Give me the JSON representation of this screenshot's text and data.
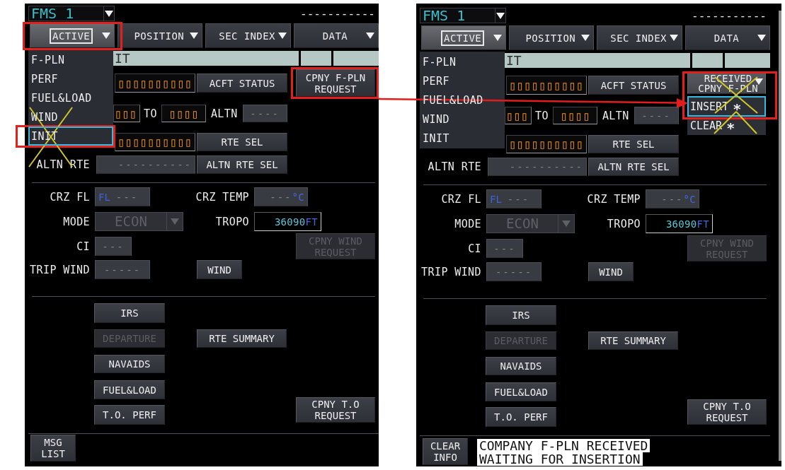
{
  "panels": [
    {
      "fms_selector": {
        "value": "FMS 1"
      },
      "header_dashes": "-----------",
      "tabs": [
        {
          "label": "ACTIVE",
          "selected": true,
          "highlighted": true,
          "menu": {
            "crossed": true,
            "items": [
              {
                "label": "F-PLN",
                "selected": false,
                "highlighted": false
              },
              {
                "label": "PERF",
                "selected": false,
                "highlighted": false
              },
              {
                "label": "FUEL&LOAD",
                "selected": false,
                "highlighted": false
              },
              {
                "label": "WIND",
                "selected": false,
                "highlighted": false
              },
              {
                "label": "INIT",
                "selected": true,
                "highlighted": true
              }
            ]
          }
        },
        {
          "label": "POSITION",
          "selected": false,
          "highlighted": false
        },
        {
          "label": "SEC INDEX",
          "selected": false,
          "highlighted": false
        },
        {
          "label": "DATA",
          "selected": false,
          "highlighted": false
        }
      ],
      "title_bar": {
        "title": "IT"
      },
      "entry_rows": [
        {
          "kind": "field_button",
          "field": {
            "kind": "amber",
            "value": "▯▯▯▯▯▯▯▯▯▯"
          },
          "button": {
            "label": "ACFT STATUS",
            "disabled": false
          }
        },
        {
          "kind": "from_to",
          "from_field": {
            "kind": "amber",
            "value": "▯▯▯"
          },
          "to_label": "TO",
          "to_field": {
            "kind": "amber",
            "value": "▯▯▯▯"
          },
          "altn_label": "ALTN",
          "altn_field": {
            "kind": "empty",
            "placeholder": "----"
          }
        },
        {
          "kind": "field_button",
          "field": {
            "kind": "amber",
            "value": "▯▯▯▯▯▯▯▯▯▯"
          },
          "button": {
            "label": "RTE SEL",
            "disabled": false
          }
        },
        {
          "kind": "field_button",
          "label": "ALTN RTE",
          "field": {
            "kind": "empty",
            "placeholder": "----------"
          },
          "button": {
            "label": "ALTN RTE SEL",
            "disabled": false
          }
        }
      ],
      "company_fpln": {
        "kind": "button",
        "label": "CPNY F-PLN REQUEST",
        "highlighted": true,
        "crossed": false
      },
      "cruise": {
        "crz_fl": {
          "label": "CRZ FL",
          "field": {
            "kind": "empty",
            "prefix": "FL",
            "placeholder": "---"
          }
        },
        "crz_temp": {
          "label": "CRZ TEMP",
          "field": {
            "kind": "empty",
            "placeholder": "---",
            "unit": "°C"
          }
        },
        "mode": {
          "label": "MODE",
          "value": "ECON",
          "disabled": true
        },
        "tropo": {
          "label": "TROPO",
          "field": {
            "kind": "value",
            "value": "36090",
            "unit": "FT"
          }
        },
        "cpny_wind_request": {
          "label": "CPNY WIND REQUEST",
          "disabled": true
        },
        "ci": {
          "label": "CI",
          "field": {
            "kind": "empty",
            "placeholder": "---"
          }
        },
        "trip_wind": {
          "label": "TRIP WIND",
          "field": {
            "kind": "empty",
            "placeholder": "-----"
          }
        },
        "wind_button": {
          "label": "WIND",
          "disabled": false
        }
      },
      "page_buttons": [
        {
          "label": "IRS",
          "disabled": false
        },
        {
          "label": "DEPARTURE",
          "disabled": true
        },
        {
          "label": "NAVAIDS",
          "disabled": false
        },
        {
          "label": "FUEL&LOAD",
          "disabled": false
        },
        {
          "label": "T.O. PERF",
          "disabled": false
        }
      ],
      "rte_summary_button": {
        "label": "RTE SUMMARY",
        "disabled": false
      },
      "cpny_to_request": {
        "label": "CPNY T.O REQUEST",
        "disabled": false
      },
      "footer": {
        "button": {
          "label": "MSG LIST"
        }
      },
      "scrollbar_shown": false
    },
    {
      "fms_selector": {
        "value": "FMS 1"
      },
      "header_dashes": "-----------",
      "tabs": [
        {
          "label": "ACTIVE",
          "selected": true,
          "highlighted": false,
          "menu": {
            "crossed": false,
            "items": [
              {
                "label": "F-PLN",
                "selected": false,
                "highlighted": false
              },
              {
                "label": "PERF",
                "selected": false,
                "highlighted": false
              },
              {
                "label": "FUEL&LOAD",
                "selected": false,
                "highlighted": false
              },
              {
                "label": "WIND",
                "selected": false,
                "highlighted": false
              },
              {
                "label": "INIT",
                "selected": false,
                "highlighted": false
              }
            ]
          }
        },
        {
          "label": "POSITION",
          "selected": false,
          "highlighted": false
        },
        {
          "label": "SEC INDEX",
          "selected": false,
          "highlighted": false
        },
        {
          "label": "DATA",
          "selected": false,
          "highlighted": false
        }
      ],
      "title_bar": {
        "title": "IT"
      },
      "entry_rows": [
        {
          "kind": "field_button",
          "field": {
            "kind": "amber",
            "value": "▯▯▯▯▯▯▯▯▯▯"
          },
          "button": {
            "label": "ACFT STATUS",
            "disabled": false
          }
        },
        {
          "kind": "from_to",
          "from_field": {
            "kind": "amber",
            "value": "▯▯▯"
          },
          "to_label": "TO",
          "to_field": {
            "kind": "amber",
            "value": "▯▯▯▯"
          },
          "altn_label": "ALTN",
          "altn_field": {
            "kind": "empty",
            "placeholder": "----"
          }
        },
        {
          "kind": "field_button",
          "field": {
            "kind": "amber",
            "value": "▯▯▯▯▯▯▯▯▯▯"
          },
          "button": {
            "label": "RTE SEL",
            "disabled": false
          }
        },
        {
          "kind": "field_button",
          "label": "ALTN RTE",
          "field": {
            "kind": "empty",
            "placeholder": "----------"
          },
          "button": {
            "label": "ALTN RTE SEL",
            "disabled": false
          }
        }
      ],
      "company_fpln": {
        "kind": "menu",
        "label": "RECEIVED CPNY F-PLN",
        "highlighted": true,
        "crossed": true,
        "items": [
          {
            "label": "INSERT",
            "symbol": "*",
            "selected": true
          },
          {
            "label": "CLEAR",
            "symbol": "*",
            "selected": false
          }
        ]
      },
      "cruise": {
        "crz_fl": {
          "label": "CRZ FL",
          "field": {
            "kind": "empty",
            "prefix": "FL",
            "placeholder": "---"
          }
        },
        "crz_temp": {
          "label": "CRZ TEMP",
          "field": {
            "kind": "empty",
            "placeholder": "---",
            "unit": "°C"
          }
        },
        "mode": {
          "label": "MODE",
          "value": "ECON",
          "disabled": true
        },
        "tropo": {
          "label": "TROPO",
          "field": {
            "kind": "value",
            "value": "36090",
            "unit": "FT"
          }
        },
        "cpny_wind_request": {
          "label": "CPNY WIND REQUEST",
          "disabled": true
        },
        "ci": {
          "label": "CI",
          "field": {
            "kind": "empty",
            "placeholder": "---"
          }
        },
        "trip_wind": {
          "label": "TRIP WIND",
          "field": {
            "kind": "empty",
            "placeholder": "-----"
          }
        },
        "wind_button": {
          "label": "WIND",
          "disabled": false
        }
      },
      "page_buttons": [
        {
          "label": "IRS",
          "disabled": false
        },
        {
          "label": "DEPARTURE",
          "disabled": true
        },
        {
          "label": "NAVAIDS",
          "disabled": false
        },
        {
          "label": "FUEL&LOAD",
          "disabled": false
        },
        {
          "label": "T.O. PERF",
          "disabled": false
        }
      ],
      "rte_summary_button": {
        "label": "RTE SUMMARY",
        "disabled": false
      },
      "cpny_to_request": {
        "label": "CPNY T.O REQUEST",
        "disabled": false
      },
      "footer": {
        "button": {
          "label": "CLEAR INFO"
        },
        "message_lines": [
          "COMPANY F-PLN RECEIVED",
          "WAITING FOR INSERTION"
        ]
      },
      "scrollbar_shown": true
    }
  ]
}
